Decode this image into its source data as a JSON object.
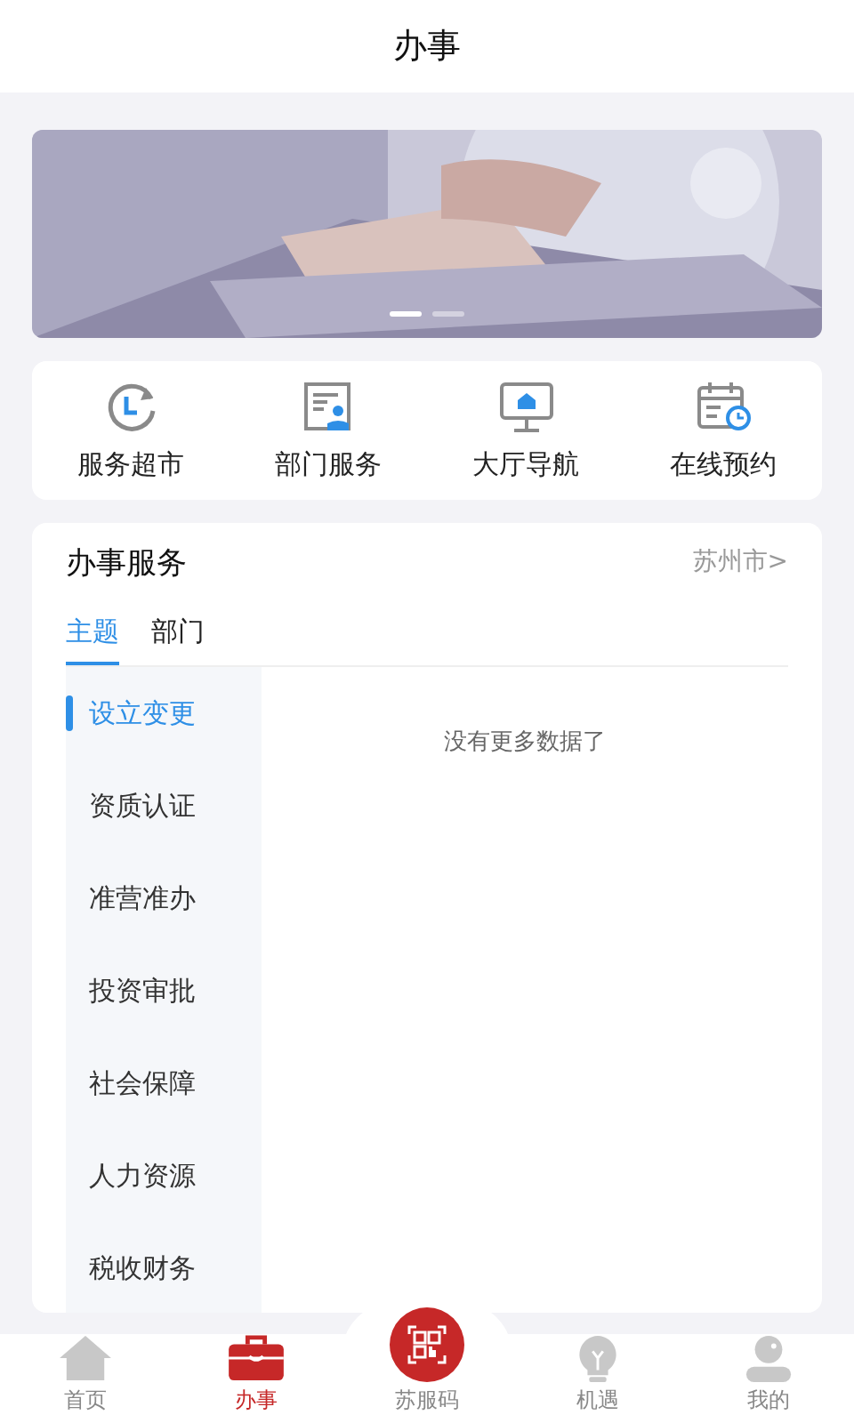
{
  "header": {
    "title": "办事"
  },
  "banner": {
    "kind": "picture",
    "dots": [
      {
        "selected": true
      },
      {
        "selected": false
      }
    ]
  },
  "shortcuts": [
    {
      "kind": "clock",
      "label": "服务超市"
    },
    {
      "kind": "person",
      "label": "部门服务"
    },
    {
      "kind": "monitor",
      "label": "大厅导航"
    },
    {
      "kind": "calendar",
      "label": "在线预约"
    }
  ],
  "service": {
    "title": "办事服务",
    "city": "苏州市>",
    "tabs": [
      {
        "label": "主题",
        "selected": true
      },
      {
        "label": "部门",
        "selected": false
      }
    ],
    "categories": [
      {
        "label": "设立变更",
        "selected": true
      },
      {
        "label": "资质认证",
        "selected": false
      },
      {
        "label": "准营准办",
        "selected": false
      },
      {
        "label": "投资审批",
        "selected": false
      },
      {
        "label": "社会保障",
        "selected": false
      },
      {
        "label": "人力资源",
        "selected": false
      },
      {
        "label": "税收财务",
        "selected": false
      }
    ],
    "empty_message": "没有更多数据了"
  },
  "nav": [
    {
      "kind": "home",
      "label": "首页",
      "selected": false
    },
    {
      "kind": "toolbox",
      "label": "办事",
      "selected": true
    },
    {
      "kind": "qr",
      "label": "苏服码",
      "selected": false
    },
    {
      "kind": "bulb",
      "label": "机遇",
      "selected": false
    },
    {
      "kind": "user",
      "label": "我的",
      "selected": false
    }
  ]
}
